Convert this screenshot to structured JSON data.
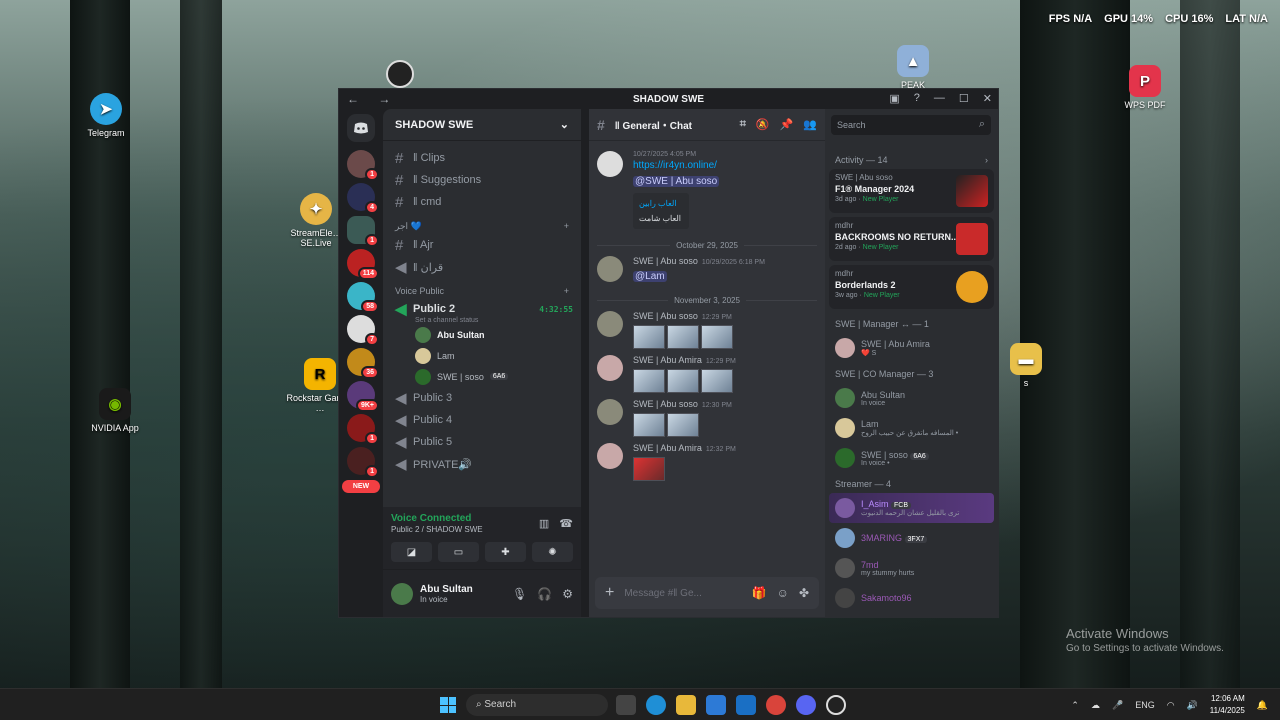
{
  "hud": {
    "fps_label": "FPS",
    "fps": "N/A",
    "gpu_label": "GPU",
    "gpu": "14%",
    "cpu_label": "CPU",
    "cpu": "16%",
    "lat_label": "LAT",
    "lat": "N/A"
  },
  "desktop_icons": {
    "telegram": "Telegram",
    "streamelements": "StreamEle… SE.Live",
    "rockstar": "Rockstar Games …",
    "nvidia": "NVIDIA App",
    "peak": "PEAK",
    "wps": "WPS PDF",
    "folder": "s"
  },
  "activate": {
    "title": "Activate Windows",
    "subtitle": "Go to Settings to activate Windows."
  },
  "window": {
    "title": "SHADOW SWE",
    "nav": "← →"
  },
  "guild_badges": [
    "1",
    "4",
    "1",
    "114",
    "58",
    "7",
    "36",
    "9K+",
    "1",
    "1"
  ],
  "new_badge": "NEW",
  "server": {
    "name": "SHADOW SWE",
    "channels": [
      {
        "label": "‖ Clips"
      },
      {
        "label": "‖ Suggestions"
      },
      {
        "label": "‖ cmd"
      }
    ],
    "cat_ajr": "اجر 💙",
    "ajr_channels": [
      {
        "label": "‖ Ajr"
      },
      {
        "label": "‖ قران"
      }
    ],
    "voice_cat": "Voice Public",
    "public2": "Public 2",
    "public2_time": "4:32:55",
    "channel_status": "Set a channel status",
    "voice_users": [
      "Abu Sultan",
      "Lam",
      "SWE | soso"
    ],
    "voice_user_tag": "6A6",
    "other_voice": [
      "Public 3",
      "Public 4",
      "Public 5",
      "PRIVATE🔊"
    ]
  },
  "voice": {
    "status": "Voice Connected",
    "channel": "Public 2 / SHADOW SWE"
  },
  "user": {
    "name": "Abu Sultan",
    "status": "In voice"
  },
  "chat": {
    "channel": "‖ General・Chat",
    "messages": {
      "m1_time": "10/27/2025 4:05 PM",
      "m1_link": "https://ir4yn.online/",
      "m1_mention": "@SWE | Abu soso",
      "embed_title": "العاب رابين",
      "embed_desc": "العاب شامت",
      "sep1": "October 29, 2025",
      "m2_author": "SWE | Abu soso",
      "m2_time": "10/29/2025 6:18 PM",
      "m2_mention": "@Lam",
      "sep2": "November 3, 2025",
      "m3_author": "SWE | Abu soso",
      "m3_time": "12:29 PM",
      "m4_author": "SWE | Abu Amira",
      "m4_time": "12:29 PM",
      "m5_author": "SWE | Abu soso",
      "m5_time": "12:30 PM",
      "m6_author": "SWE | Abu Amira",
      "m6_time": "12:32 PM"
    },
    "composer_placeholder": "Message #‖ Ge..."
  },
  "members": {
    "search_placeholder": "Search",
    "activity_header": "Activity — 14",
    "activities": [
      {
        "user": "SWE | Abu soso",
        "game": "F1® Manager 2024",
        "ago": "3d ago",
        "tag": "New Player"
      },
      {
        "user": "mdhr",
        "game": "BACKROOMS NO RETURN...",
        "ago": "2d ago",
        "tag": "New Player"
      },
      {
        "user": "mdhr",
        "game": "Borderlands 2",
        "ago": "3w ago",
        "tag": "New Player"
      }
    ],
    "manager_header": "SWE | Manager ↔ — 1",
    "manager": [
      {
        "name": "SWE | Abu Amira",
        "status": "❤️ S"
      }
    ],
    "co_header": "SWE | CO Manager — 3",
    "co": [
      {
        "name": "Abu Sultan",
        "status": "In voice"
      },
      {
        "name": "Lam",
        "status": "المسافه ماتفرق عن حبيب الروح •"
      },
      {
        "name": "SWE | soso",
        "status": "In voice •",
        "tag": "6A6"
      }
    ],
    "streamer_header": "Streamer — 4",
    "streamers": [
      {
        "name": "I_Asim",
        "status": "ترى بالقليل عشان الرحمه الدنيوت",
        "tag": "FCB"
      },
      {
        "name": "3MARING",
        "status": "",
        "tag": "3FX7"
      },
      {
        "name": "7md",
        "status": "my stummy hurts",
        "tag": ""
      },
      {
        "name": "Sakamoto96",
        "status": "",
        "tag": ""
      }
    ]
  },
  "taskbar": {
    "search": "Search",
    "lang": "ENG",
    "time": "12:06 AM",
    "date": "11/4/2025"
  }
}
